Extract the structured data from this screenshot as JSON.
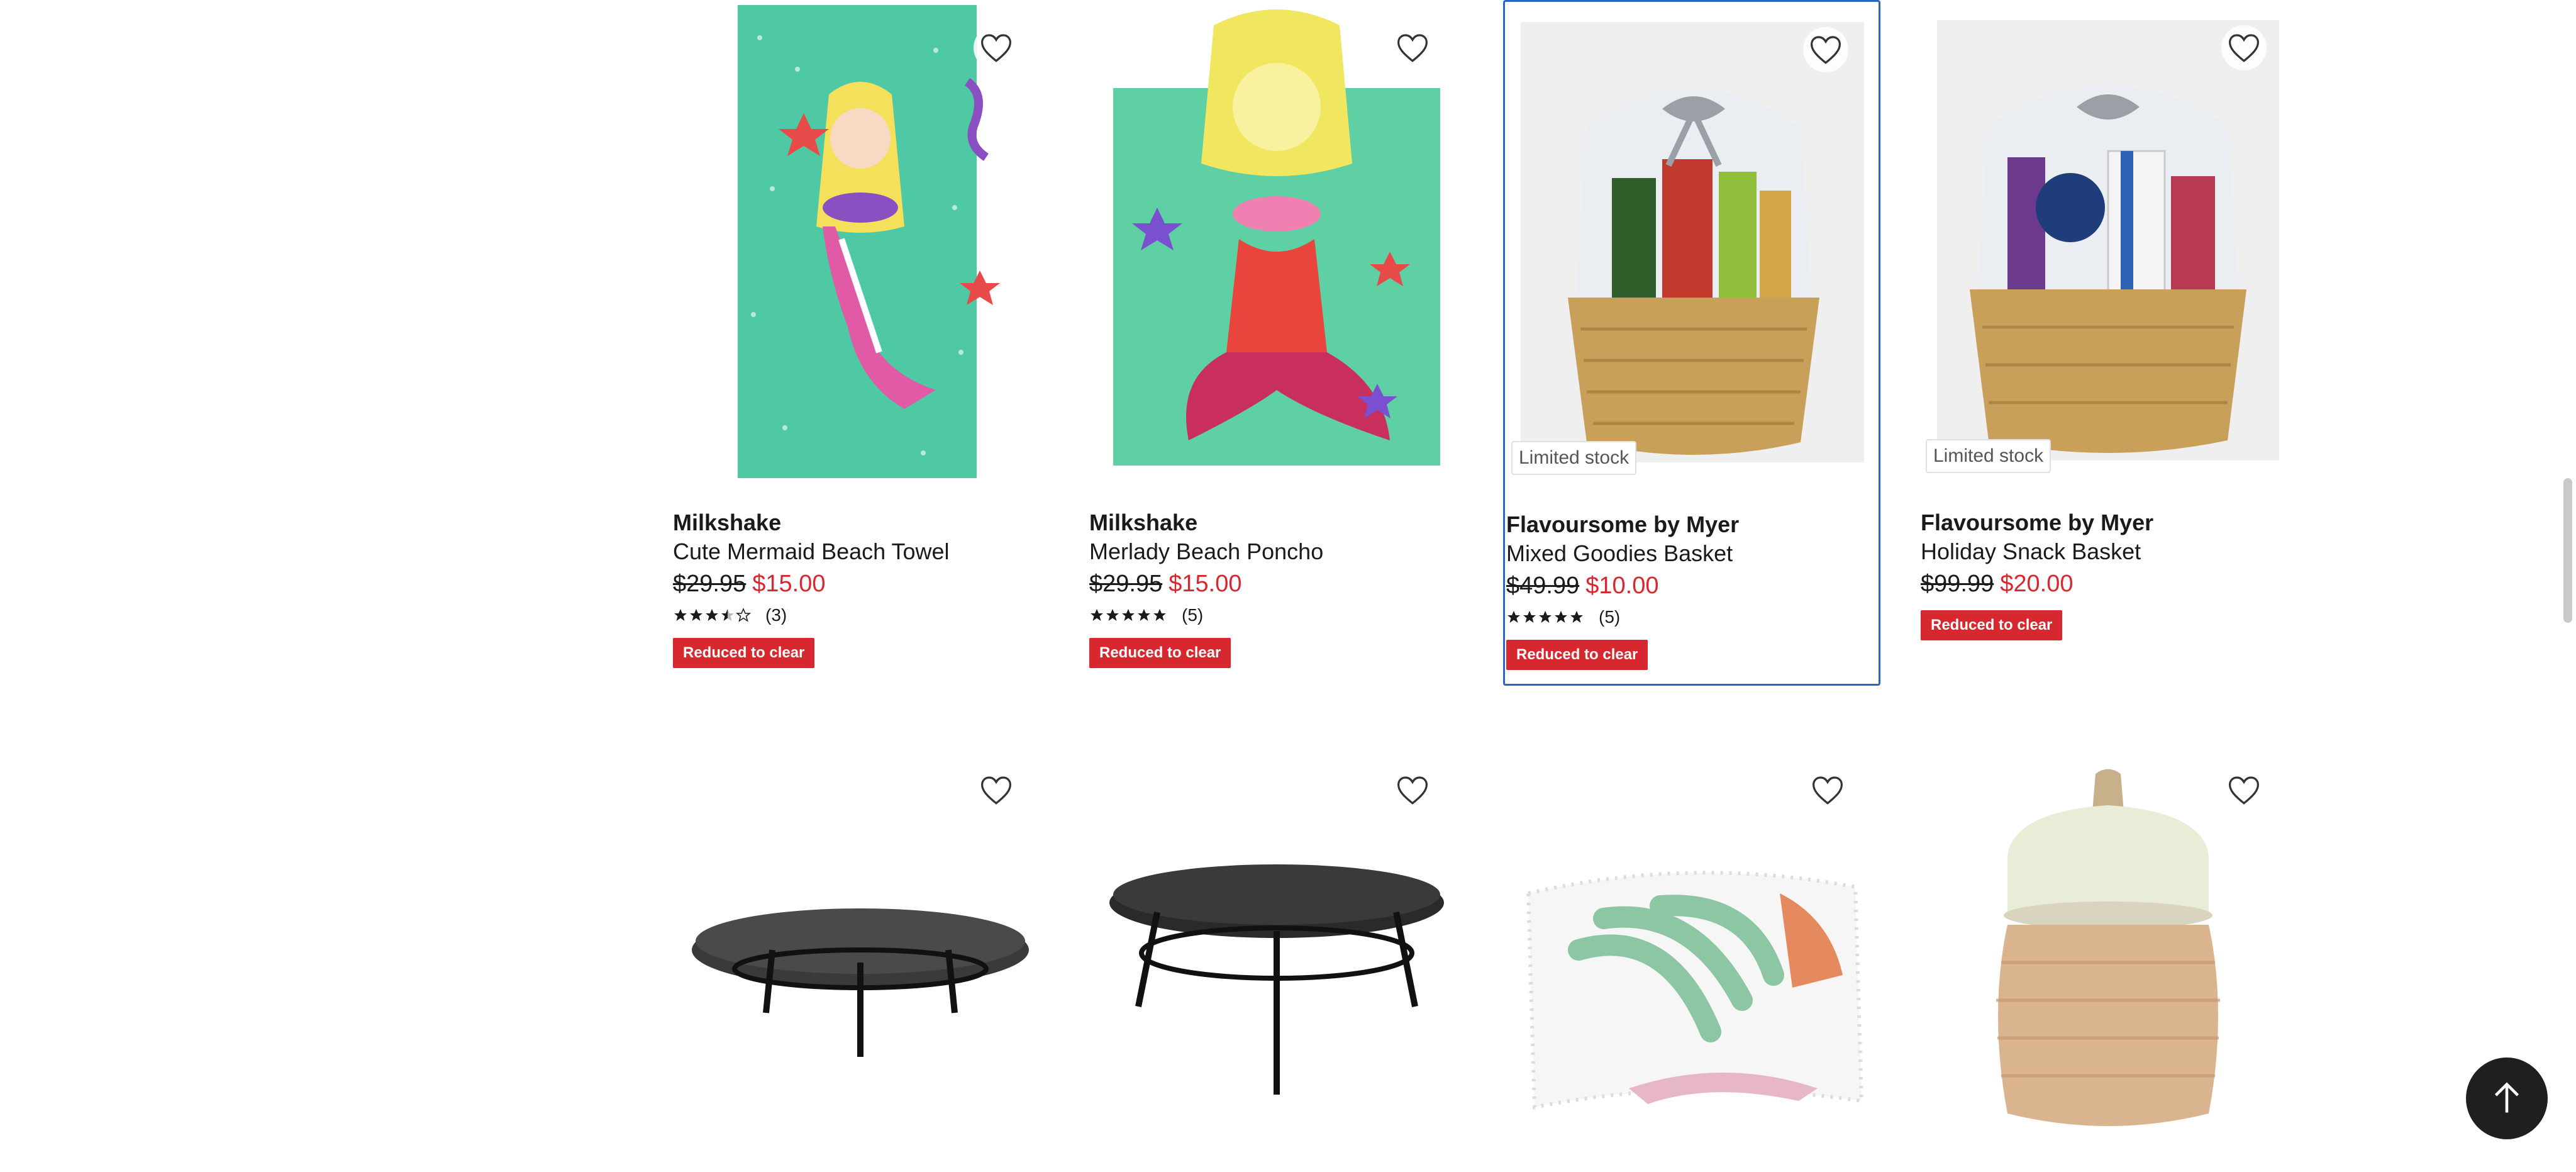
{
  "colors": {
    "accent": "#d7282f",
    "selected_border": "#2c63c4",
    "back_to_top": "#1f1f1f"
  },
  "products": [
    {
      "brand": "Milkshake",
      "name": "Cute Mermaid Beach Towel",
      "was_price": "$29.95",
      "now_price": "$15.00",
      "rating": 3.5,
      "reviews": "(3)",
      "promo": "Reduced to clear",
      "wishlist_icon": "heart-outline-icon"
    },
    {
      "brand": "Milkshake",
      "name": "Merlady Beach Poncho",
      "was_price": "$29.95",
      "now_price": "$15.00",
      "rating": 5,
      "reviews": "(5)",
      "promo": "Reduced to clear",
      "wishlist_icon": "heart-outline-icon"
    },
    {
      "brand": "Flavoursome by Myer",
      "name": "Mixed Goodies Basket",
      "was_price": "$49.99",
      "now_price": "$10.00",
      "rating": 5,
      "reviews": "(5)",
      "promo": "Reduced to clear",
      "stock": "Limited stock",
      "wishlist_icon": "heart-outline-icon"
    },
    {
      "brand": "Flavoursome by Myer",
      "name": "Holiday Snack Basket",
      "was_price": "$99.99",
      "now_price": "$20.00",
      "promo": "Reduced to clear",
      "stock": "Limited stock",
      "wishlist_icon": "heart-outline-icon"
    }
  ],
  "row2": [
    {
      "image": "marble-tray-stand-image",
      "wishlist_icon": "heart-outline-icon"
    },
    {
      "image": "black-tray-stand-image",
      "wishlist_icon": "heart-outline-icon"
    },
    {
      "image": "leaf-print-cushion-image",
      "wishlist_icon": "heart-outline-icon"
    },
    {
      "image": "ceramic-canister-image",
      "wishlist_icon": "heart-outline-icon"
    }
  ],
  "back_to_top_icon": "arrow-up-icon"
}
